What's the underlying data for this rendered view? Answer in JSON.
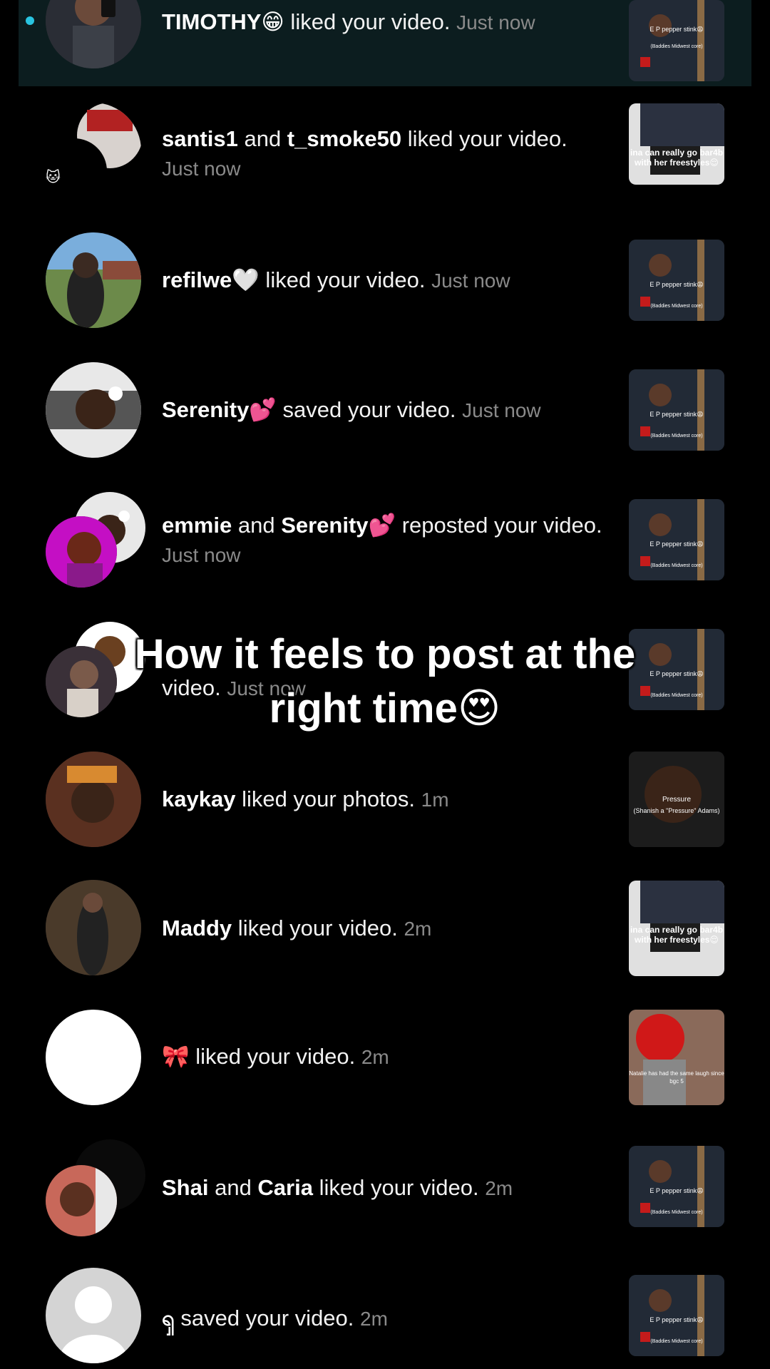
{
  "notifications": [
    {
      "avatar_icon": "user-photo",
      "user1": "TIMOTHY😁",
      "connector": "",
      "user2": "",
      "action": " liked your video.",
      "time": "Just now",
      "thumb": "pepper",
      "unread": true
    },
    {
      "avatar_icon": "user-photo",
      "user1": "santis1",
      "connector": " and ",
      "user2": "t_smoke50",
      "action": " liked your video.",
      "time": "Just now",
      "thumb": "freestyle"
    },
    {
      "avatar_icon": "user-photo",
      "user1": "refilwe🤍",
      "connector": "",
      "user2": "",
      "action": " liked your video.",
      "time": "Just now",
      "thumb": "pepper"
    },
    {
      "avatar_icon": "user-photo",
      "user1": "Serenity💕",
      "connector": "",
      "user2": "",
      "action": " saved your video.",
      "time": "Just now",
      "thumb": "pepper"
    },
    {
      "avatar_icon": "user-photo",
      "user1": "emmie",
      "connector": " and ",
      "user2": "Serenity💕",
      "action": " reposted your video.",
      "time": "Just now",
      "thumb": "pepper"
    },
    {
      "avatar_icon": "user-photo",
      "user1": "",
      "connector": "",
      "user2": "",
      "action": "video.",
      "time": "Just now",
      "thumb": "pepper"
    },
    {
      "avatar_icon": "user-photo",
      "user1": "kaykay",
      "connector": "",
      "user2": "",
      "action": " liked your photos.",
      "time": "1m",
      "thumb": "pressure"
    },
    {
      "avatar_icon": "user-photo",
      "user1": "Maddy",
      "connector": "",
      "user2": "",
      "action": " liked your video.",
      "time": "2m",
      "thumb": "freestyle"
    },
    {
      "avatar_icon": "blank-avatar",
      "user1": "🎀",
      "connector": "",
      "user2": "",
      "action": " liked your video.",
      "time": "2m",
      "thumb": "natalie"
    },
    {
      "avatar_icon": "user-photo",
      "user1": "Shai",
      "connector": " and ",
      "user2": "Caria",
      "action": " liked your video.",
      "time": "2m",
      "thumb": "pepper"
    },
    {
      "avatar_icon": "default-avatar",
      "user1": "ၡ",
      "connector": "",
      "user2": "",
      "action": " saved your video.",
      "time": "2m",
      "thumb": "pepper"
    }
  ],
  "thumb_captions": {
    "pepper_1": "E P pepper stink😩",
    "pepper_2": "(Baddies Midwest core)",
    "freestyle": "ina can really go bar4b with her freestyles😌",
    "pressure_1": "Pressure",
    "pressure_2": "(Shanish a \"Pressure\" Adams)",
    "natalie": "Natalie has had the same laugh since bgc 5"
  },
  "overlay_caption": {
    "line1": "How it feels to post at the",
    "line2": "right time😍"
  },
  "colors": {
    "background": "#000000",
    "highlight_row": "#0c1d1f",
    "unread_dot": "#29c4e0",
    "timestamp": "#8a8a8a"
  }
}
